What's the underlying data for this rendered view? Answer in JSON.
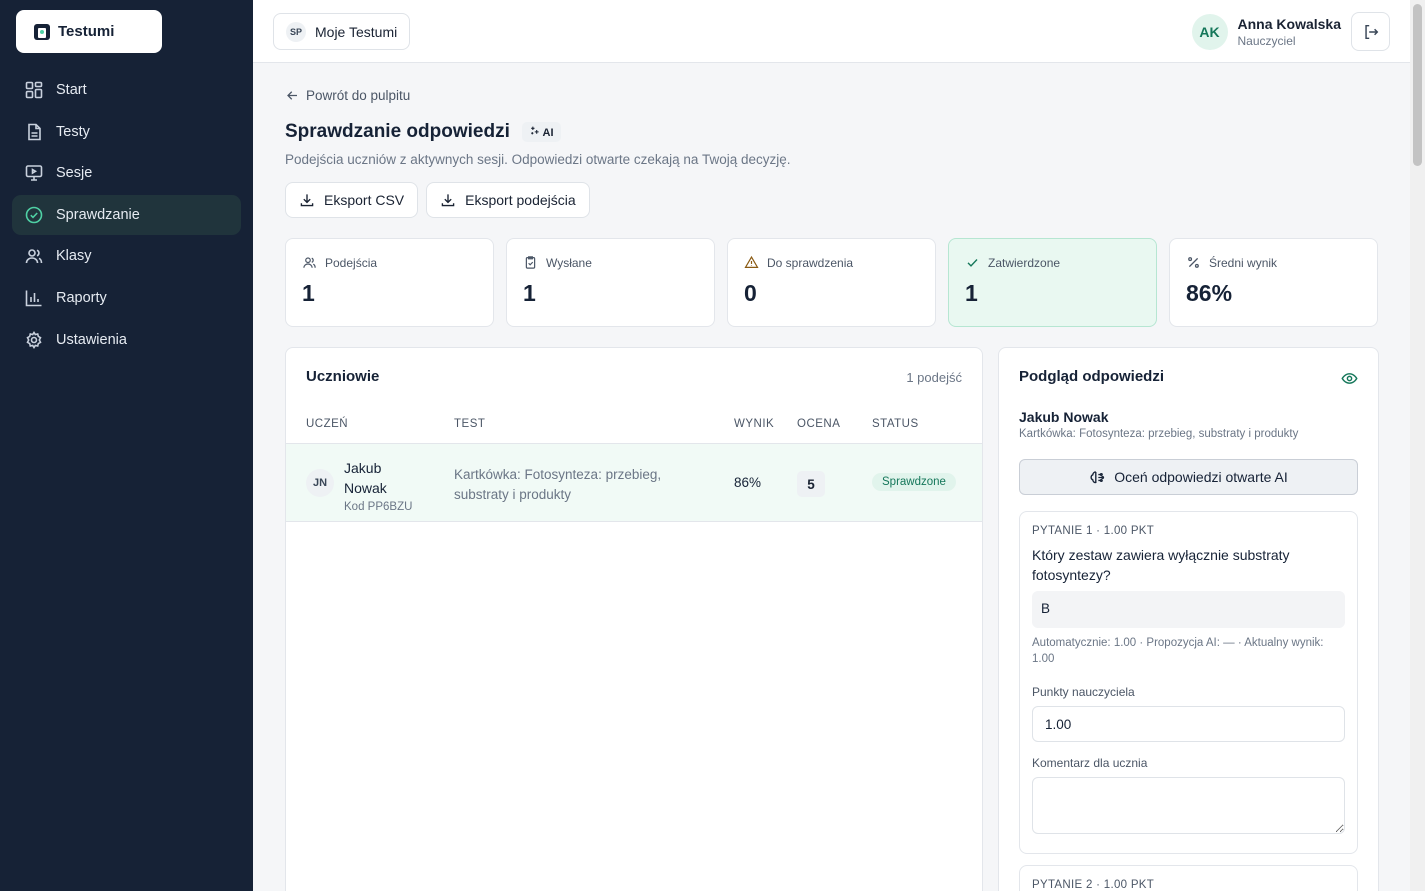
{
  "app": {
    "brand": "Testumi"
  },
  "sidebar": {
    "items": [
      {
        "label": "Start",
        "icon": "grid-icon"
      },
      {
        "label": "Testy",
        "icon": "document-icon"
      },
      {
        "label": "Sesje",
        "icon": "monitor-icon"
      },
      {
        "label": "Sprawdzanie",
        "icon": "check-circle-icon",
        "active": true
      },
      {
        "label": "Klasy",
        "icon": "users-icon"
      },
      {
        "label": "Raporty",
        "icon": "bar-chart-icon"
      },
      {
        "label": "Ustawienia",
        "icon": "gear-icon"
      }
    ]
  },
  "topbar": {
    "workspace_initials": "SP",
    "workspace_name": "Moje Testumi",
    "user_initials": "AK",
    "user_name": "Anna Kowalska",
    "user_role": "Nauczyciel"
  },
  "page": {
    "back_label": "Powrót do pulpitu",
    "title": "Sprawdzanie odpowiedzi",
    "ai_badge": "AI",
    "subtitle": "Podejścia uczniów z aktywnych sesji. Odpowiedzi otwarte czekają na Twoją decyzję.",
    "export_csv": "Eksport CSV",
    "export_attempts": "Eksport podejścia"
  },
  "stats": [
    {
      "label": "Podejścia",
      "value": "1"
    },
    {
      "label": "Wysłane",
      "value": "1"
    },
    {
      "label": "Do sprawdzenia",
      "value": "0"
    },
    {
      "label": "Zatwierdzone",
      "value": "1"
    },
    {
      "label": "Średni wynik",
      "value": "86%"
    }
  ],
  "students": {
    "title": "Uczniowie",
    "count": "1 podejść",
    "headers": [
      "UCZEŃ",
      "TEST",
      "WYNIK",
      "OCENA",
      "STATUS"
    ],
    "rows": [
      {
        "initials": "JN",
        "name": "Jakub Nowak",
        "code": "Kod PP6BZU",
        "test": "Kartkówka: Fotosynteza: przebieg, substraty i produkty",
        "score": "86%",
        "grade": "5",
        "status": "Sprawdzone"
      }
    ]
  },
  "preview": {
    "title": "Podgląd odpowiedzi",
    "student_name": "Jakub Nowak",
    "test_name": "Kartkówka: Fotosynteza: przebieg, substraty i produkty",
    "ai_button": "Oceń odpowiedzi otwarte AI",
    "questions": [
      {
        "header": "PYTANIE 1 · 1.00 PKT",
        "text": "Który zestaw zawiera wyłącznie substraty fotosyntezy?",
        "answer": "B",
        "meta": "Automatycznie: 1.00 · Propozycja AI: — · Aktualny wynik: 1.00",
        "points_label": "Punkty nauczyciela",
        "points_value": "1.00",
        "comment_label": "Komentarz dla ucznia",
        "comment_value": ""
      },
      {
        "header": "PYTANIE 2 · 1.00 PKT"
      }
    ]
  },
  "colors": {
    "sidebar_bg": "#162236",
    "accent": "#4fd1a5",
    "success": "#15775a"
  }
}
